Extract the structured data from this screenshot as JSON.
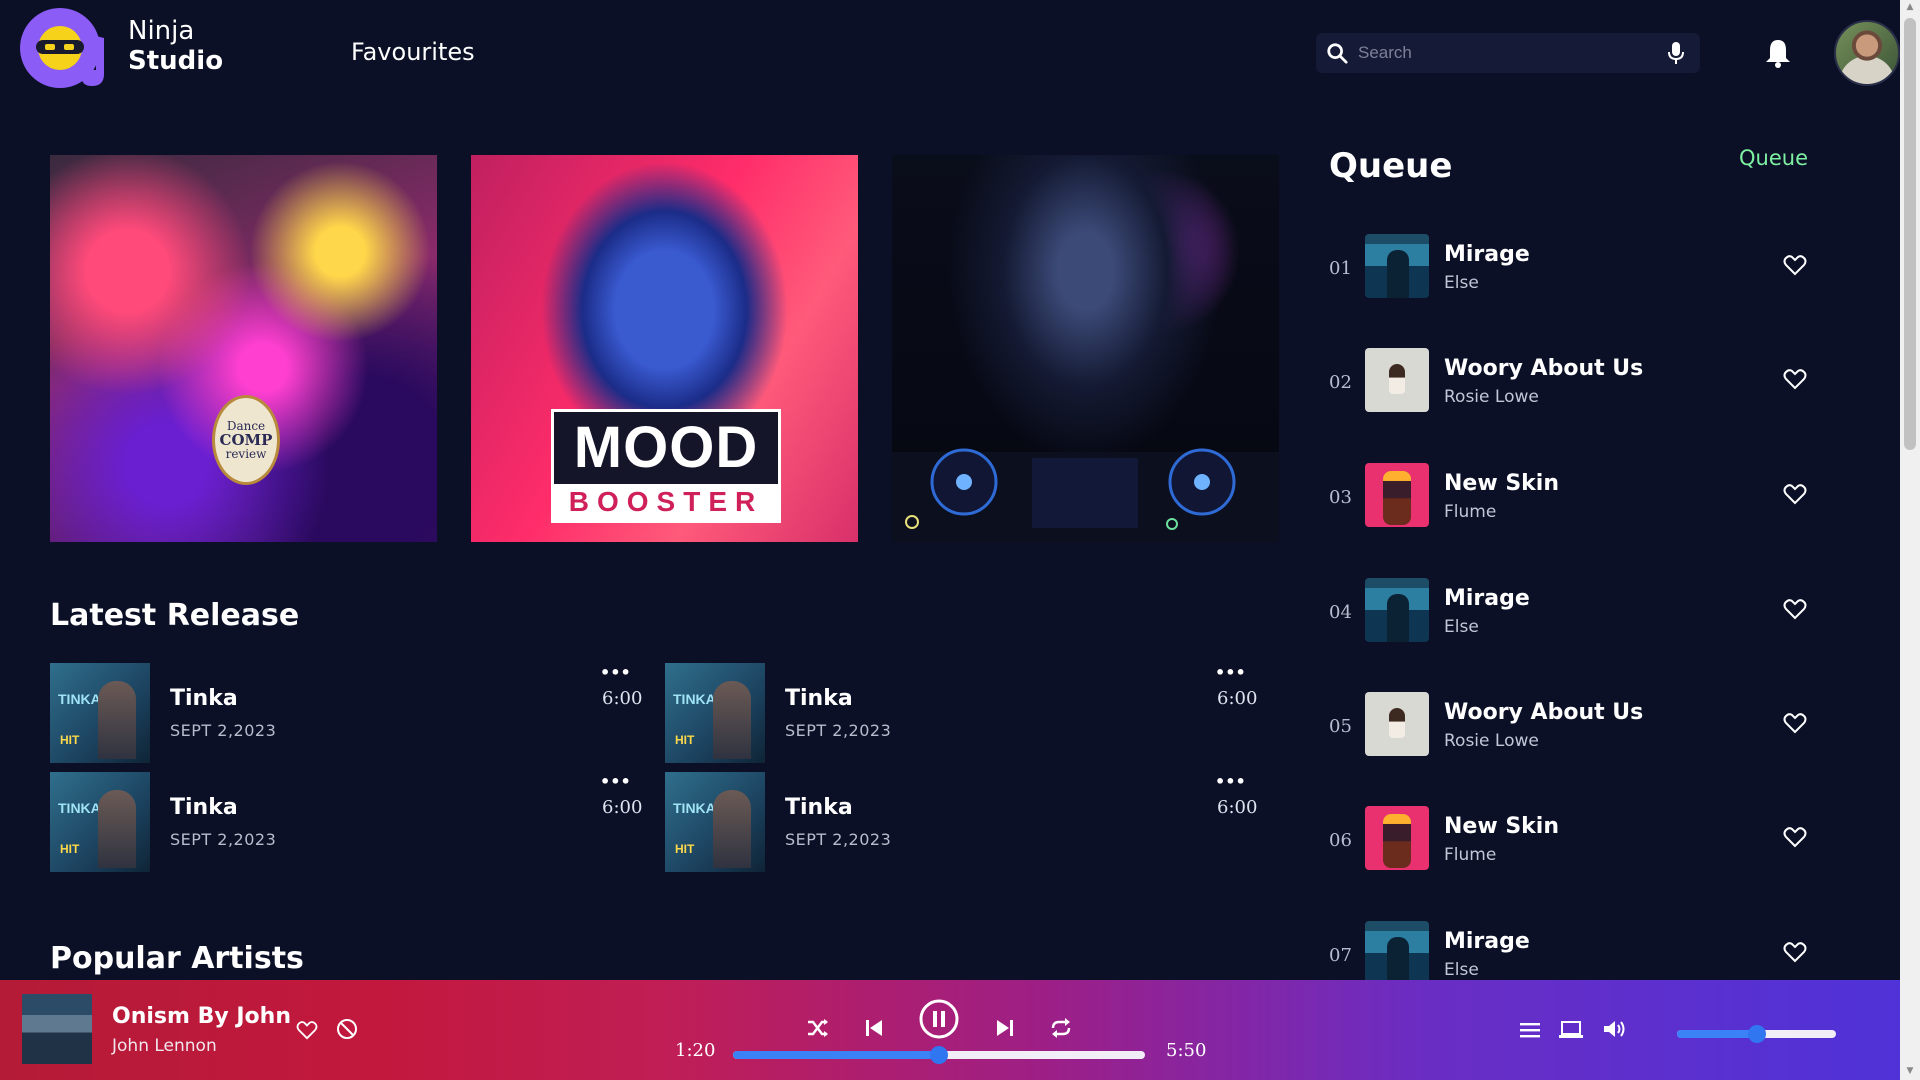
{
  "header": {
    "brand_line1": "Ninja",
    "brand_line2": "Studio",
    "nav_favourites": "Favourites",
    "search_placeholder": "Search"
  },
  "banners": [
    {
      "badge_line1": "Dance",
      "badge_line2": "COMP",
      "badge_line3": "review"
    },
    {
      "title": "MOOD",
      "subtitle": "BOOSTER"
    },
    {}
  ],
  "latest_release": {
    "heading": "Latest Release",
    "cover_text": "TINKA",
    "cover_sub": "HIT",
    "items": [
      {
        "title": "Tinka",
        "date": "SEPT 2,2023",
        "duration": "6:00",
        "more": "•••"
      },
      {
        "title": "Tinka",
        "date": "SEPT 2,2023",
        "duration": "6:00",
        "more": "•••"
      },
      {
        "title": "Tinka",
        "date": "SEPT 2,2023",
        "duration": "6:00",
        "more": "•••"
      },
      {
        "title": "Tinka",
        "date": "SEPT 2,2023",
        "duration": "6:00",
        "more": "•••"
      }
    ]
  },
  "popular_artists": {
    "heading": "Popular Artists"
  },
  "queue": {
    "heading": "Queue",
    "link": "Queue",
    "items": [
      {
        "num": "01",
        "title": "Mirage",
        "artist": "Else",
        "thumb": "mirage"
      },
      {
        "num": "02",
        "title": "Woory About Us",
        "artist": "Rosie Lowe",
        "thumb": "woory"
      },
      {
        "num": "03",
        "title": "New Skin",
        "artist": "Flume",
        "thumb": "newskin"
      },
      {
        "num": "04",
        "title": "Mirage",
        "artist": "Else",
        "thumb": "mirage"
      },
      {
        "num": "05",
        "title": "Woory About Us",
        "artist": "Rosie Lowe",
        "thumb": "woory"
      },
      {
        "num": "06",
        "title": "New Skin",
        "artist": "Flume",
        "thumb": "newskin"
      },
      {
        "num": "07",
        "title": "Mirage",
        "artist": "Else",
        "thumb": "mirage"
      }
    ]
  },
  "player": {
    "track_title": "Onism By John",
    "track_artist": "John Lennon",
    "current_time": "1:20",
    "total_time": "5:50",
    "progress_fraction": 0.5,
    "volume_fraction": 0.5,
    "accent_color": "#3b82f6"
  },
  "icons": {
    "search": "search-icon",
    "mic": "microphone-icon",
    "bell": "bell-icon",
    "heart": "heart-icon",
    "block": "block-icon",
    "shuffle": "shuffle-icon",
    "prev": "skip-previous-icon",
    "pause": "pause-icon",
    "next": "skip-next-icon",
    "repeat": "repeat-icon",
    "queue": "queue-list-icon",
    "device": "laptop-icon",
    "volume": "volume-icon"
  }
}
